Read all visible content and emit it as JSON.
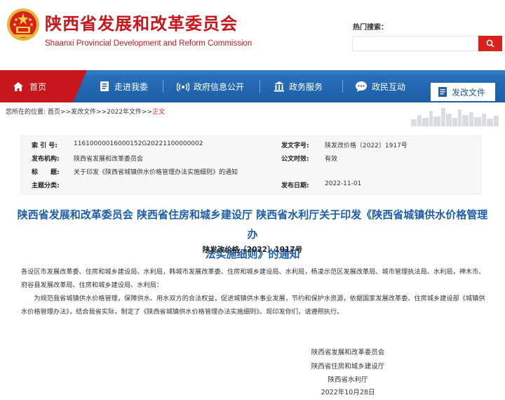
{
  "header": {
    "title_cn": "陕西省发展和改革委员会",
    "title_en": "Shaanxi Provincial Development and Reform Commission",
    "search_label": "热门搜索："
  },
  "nav": {
    "items": [
      {
        "label": "首页",
        "icon": "home-icon"
      },
      {
        "label": "走进我委",
        "icon": "document-icon"
      },
      {
        "label": "政府信息公开",
        "icon": "broadcast-icon"
      },
      {
        "label": "政务服务",
        "icon": "building-icon"
      },
      {
        "label": "政民互动",
        "icon": "chat-icon"
      },
      {
        "label": "发改文件",
        "icon": "file-icon"
      }
    ],
    "active": "发改文件"
  },
  "breadcrumb": {
    "prefix": "您所在的位置:",
    "items": [
      "首页",
      "发改文件",
      "2022年文件",
      "正文"
    ],
    "sep": ">>"
  },
  "meta": {
    "index_label": "索 引 号:",
    "index_value": "11610000016000152G20221100000002",
    "docno_label": "发文字号:",
    "docno_value": "陕发改价格〔2022〕1917号",
    "org_label": "发布机构:",
    "org_value": "陕西省发展和改革委员会",
    "valid_label": "公文时效:",
    "valid_value": "有效",
    "title_label": "标　　题:",
    "title_value": "关于印发《陕西省城镇供水价格管理办法实施细则》的通知",
    "topic_label": "主题分类:",
    "topic_value": "",
    "date_label": "发布日期:",
    "date_value": "2022-11-01"
  },
  "article": {
    "title_line1": "陕西省发展和改革委员会 陕西省住房和城乡建设厅 陕西省水利厅关于印发《陕西省城镇供水价格管理办",
    "title_line2": "法实施细则》的通知",
    "doc_number": "陕发改价格〔2022〕1917号",
    "recipients": "各设区市发展改革委、住房和城乡建设局、水利局，韩城市发展改革委、住房和城乡建设局、水利局，杨凌示范区发展改革局、城市管理执法局、水利局，神木市、府谷县发展改革局、住房和城乡建设局、水利局：",
    "paragraph": "为规范我省城镇供水价格管理，保障供水、用水双方的合法权益，促进城镇供水事业发展，节约和保护水资源，依据国家发展改革委、住房城乡建设部《城镇供水价格管理办法》，结合我省实际，制定了《陕西省城镇供水价格管理办法实施细则》。现印发你们，请遵照执行。",
    "signatures": [
      "陕西省发展和改革委员会",
      "陕西省住房和城乡建设厅",
      "陕西省水利厅",
      "2022年10月28日"
    ]
  },
  "colors": {
    "brand_red": "#c8161d",
    "nav_blue": "#1d5ea6",
    "title_blue": "#1d5ea6"
  }
}
